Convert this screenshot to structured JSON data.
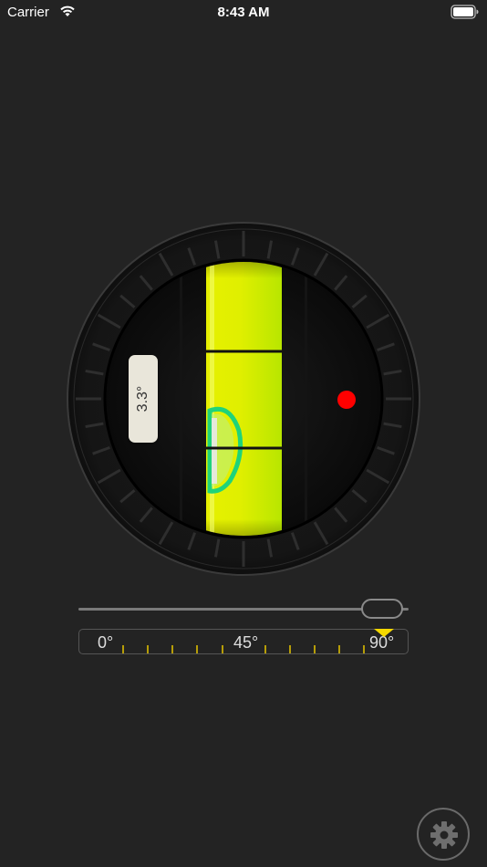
{
  "status_bar": {
    "carrier": "Carrier",
    "time": "8:43 AM",
    "wifi_icon": "wifi-icon",
    "battery_icon": "battery-full-icon"
  },
  "level": {
    "angle_reading": "3.3°",
    "vial_color": "#d9ee00",
    "target_dot_color": "#ff0000"
  },
  "slider": {
    "value_fraction": 1.0
  },
  "ruler": {
    "labels": [
      "0°",
      "45°",
      "90°"
    ],
    "pointer_color": "#f5d800",
    "tick_color": "#e8c600"
  },
  "settings": {
    "icon": "gear-icon"
  }
}
